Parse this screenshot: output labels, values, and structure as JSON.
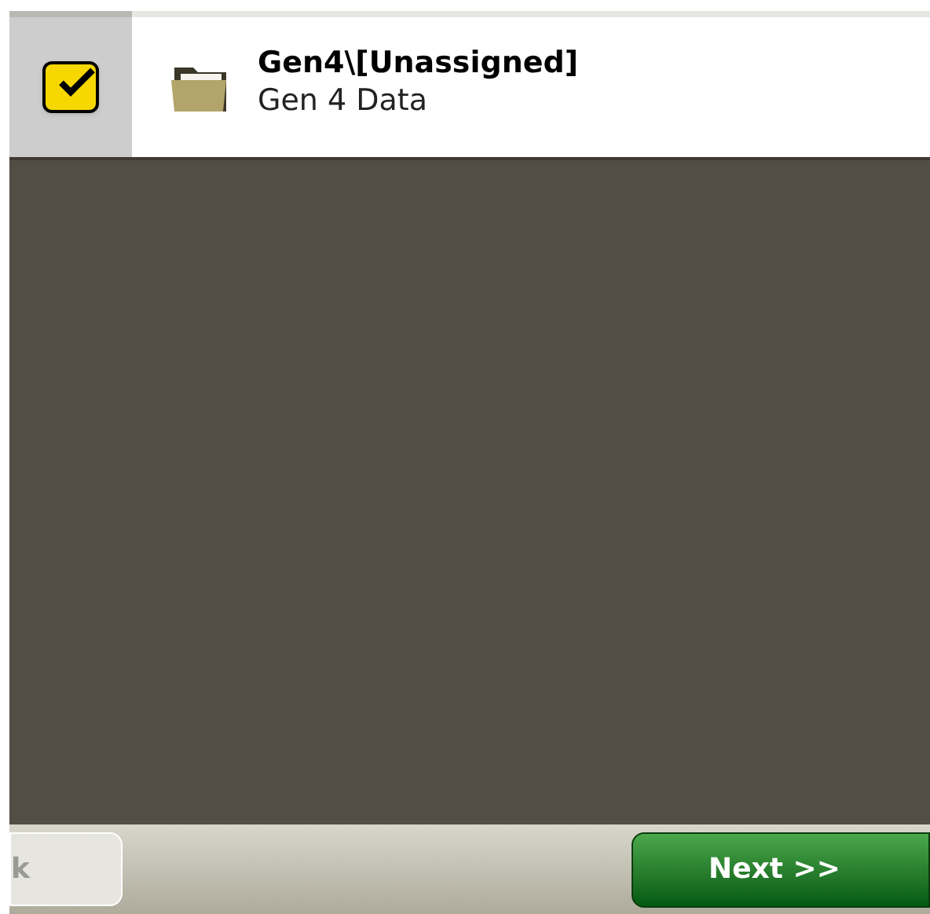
{
  "list": [
    {
      "title": "Gen4\\[Unassigned]",
      "subtitle": "Gen 4 Data",
      "checked": true
    }
  ],
  "buttons": [
    {
      "label": "k",
      "kind": "back",
      "disabled": true
    },
    {
      "label": "Next >>",
      "kind": "next",
      "disabled": false
    }
  ]
}
